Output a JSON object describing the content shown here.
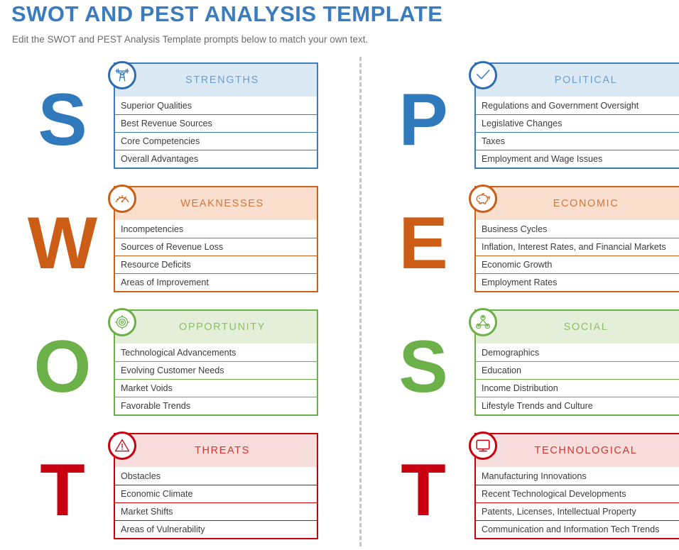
{
  "header": {
    "title": "SWOT AND PEST ANALYSIS TEMPLATE",
    "subtitle": "Edit the SWOT and PEST Analysis Template prompts below to match your own text."
  },
  "colors": {
    "blue": "#3a7cbe",
    "orange": "#cd6016",
    "green": "#6cb049",
    "red": "#c8000f",
    "title": "#3a7cbe",
    "subtitle": "#6b6b6b",
    "divider": "#c3c7c9",
    "row_text": "#3c3c3c"
  },
  "swot": {
    "quadrants": [
      {
        "letter": "S",
        "title": "STRENGTHS",
        "theme": "blue",
        "icon": "weightlifter-icon",
        "items": [
          "Superior Qualities",
          "Best Revenue Sources",
          "Core Competencies",
          "Overall Advantages"
        ]
      },
      {
        "letter": "W",
        "title": "WEAKNESSES",
        "theme": "orange",
        "icon": "gauge-icon",
        "items": [
          "Incompetencies",
          "Sources of Revenue Loss",
          "Resource Deficits",
          "Areas of Improvement"
        ]
      },
      {
        "letter": "O",
        "title": "OPPORTUNITY",
        "theme": "green",
        "icon": "target-icon",
        "items": [
          "Technological Advancements",
          "Evolving Customer Needs",
          "Market Voids",
          "Favorable Trends"
        ]
      },
      {
        "letter": "T",
        "title": "THREATS",
        "theme": "red",
        "icon": "warning-triangle-icon",
        "items": [
          "Obstacles",
          "Economic Climate",
          "Market Shifts",
          "Areas of Vulnerability"
        ]
      }
    ]
  },
  "pest": {
    "quadrants": [
      {
        "letter": "P",
        "title": "POLITICAL",
        "theme": "blue",
        "icon": "checkmark-circle-icon",
        "items": [
          "Regulations and Government Oversight",
          "Legislative Changes",
          "Taxes",
          "Employment and Wage Issues"
        ]
      },
      {
        "letter": "E",
        "title": "ECONOMIC",
        "theme": "orange",
        "icon": "piggy-bank-icon",
        "items": [
          "Business Cycles",
          "Inflation, Interest Rates, and Financial Markets",
          "Economic Growth",
          "Employment Rates"
        ]
      },
      {
        "letter": "S",
        "title": "SOCIAL",
        "theme": "green",
        "icon": "network-people-icon",
        "items": [
          "Demographics",
          "Education",
          "Income Distribution",
          "Lifestyle Trends and Culture"
        ]
      },
      {
        "letter": "T",
        "title": "TECHNOLOGICAL",
        "theme": "red",
        "icon": "monitor-icon",
        "items": [
          "Manufacturing Innovations",
          "Recent Technological Developments",
          "Patents, Licenses, Intellectual Property",
          "Communication and Information Tech Trends"
        ]
      }
    ]
  }
}
